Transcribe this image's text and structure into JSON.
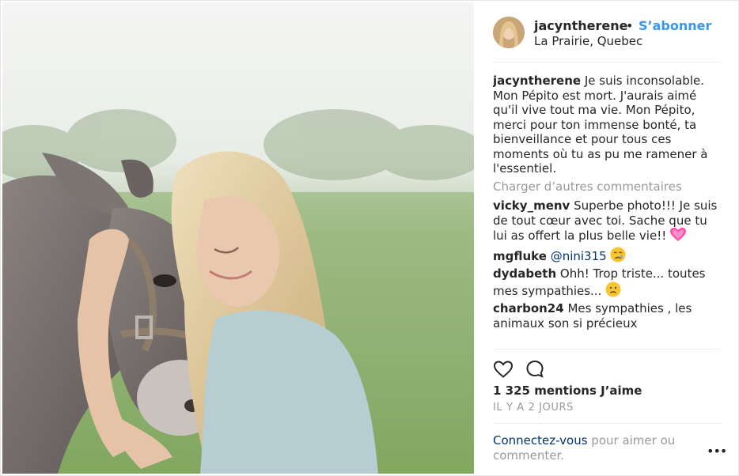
{
  "post": {
    "username": "jacyntherene",
    "separator": "•",
    "follow_label": "S’abonner",
    "location": "La Prairie, Quebec",
    "photo_icon": "donkey-woman-photo"
  },
  "caption": {
    "username": "jacyntherene",
    "text": "Je suis inconsolable. Mon Pépito est mort. J'aurais aimé qu'il vive tout ma vie. Mon Pépito, merci pour ton immense bonté, ta bienveillance et pour tous ces moments où tu as pu me ramener à l'essentiel."
  },
  "load_more_label": "Charger d’autres commentaires",
  "comments": [
    {
      "username": "vicky_menv",
      "text": "Superbe photo!!! Je suis de tout cœur avec toi. Sache que tu lui as offert la plus belle vie!!",
      "emoji": "pink-heart"
    },
    {
      "username": "mgfluke",
      "mention": "@nini315",
      "emoji": "sad-face"
    },
    {
      "username": "dydabeth",
      "text": "Ohh! Trop triste... toutes mes sympathies...",
      "emoji": "frowning-face"
    },
    {
      "username": "charbon24",
      "text": "Mes sympathies , les animaux son si précieux"
    }
  ],
  "actions": {
    "like_icon": "heart-outline-icon",
    "comment_icon": "comment-bubble-icon"
  },
  "likes_text": "1 325 mentions J’aime",
  "timestamp": "IL Y A 2 JOURS",
  "footer": {
    "login_label": "Connectez-vous",
    "rest_text": "pour aimer ou commenter.",
    "more_label": "•••"
  },
  "colors": {
    "link_blue": "#3897f0",
    "dark_link": "#003569",
    "muted": "#999999",
    "text": "#262626"
  }
}
